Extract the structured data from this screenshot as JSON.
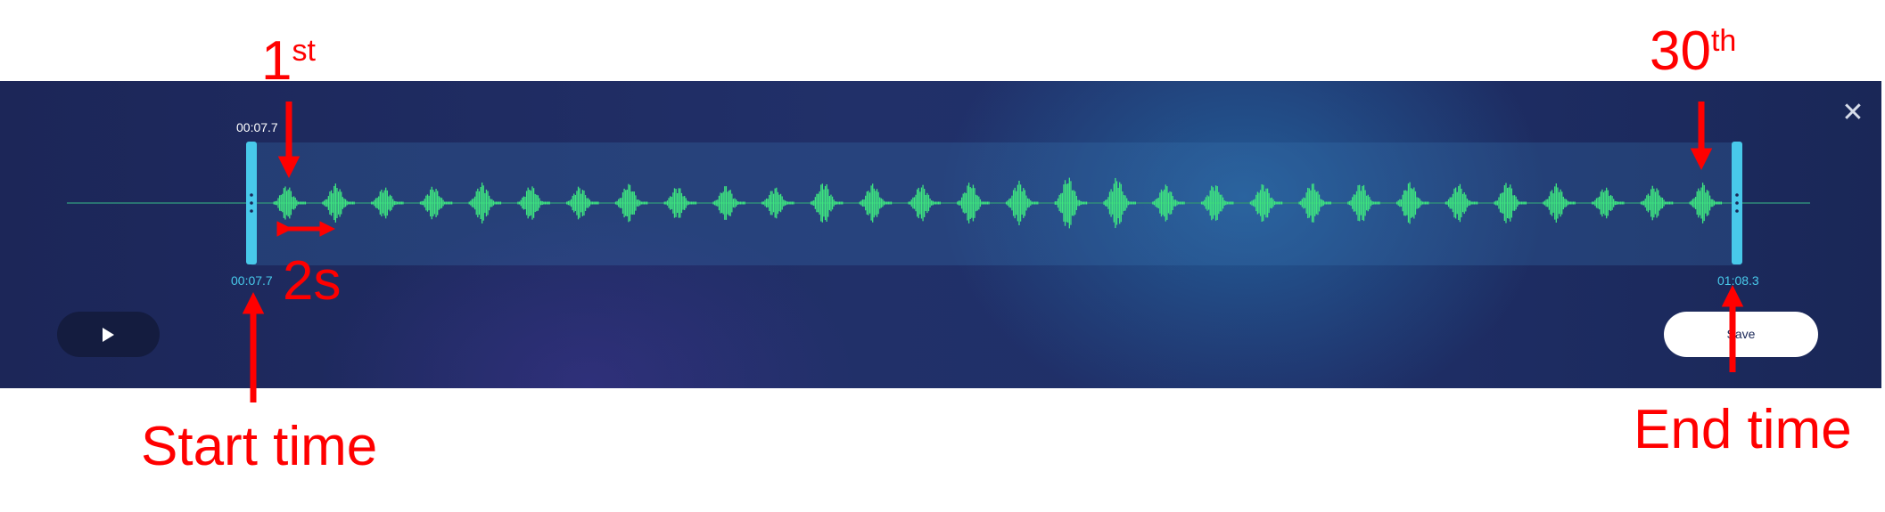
{
  "editor": {
    "selection_time_top": "00:07.7",
    "start_time": "00:07.7",
    "end_time": "01:08.3",
    "save_label": "Save",
    "close_icon": "close-icon",
    "play_icon": "play-icon"
  },
  "annotations": {
    "first_num": "1",
    "first_sup": "st",
    "last_num": "30",
    "last_sup": "th",
    "interval": "2s",
    "start_label": "Start time",
    "end_label": "End time"
  },
  "colors": {
    "annotation": "#ff0000",
    "wave": "#3ee680",
    "handle": "#48c9ea",
    "panel": "#1f2d66"
  },
  "waveform": {
    "burst_count": 30
  }
}
